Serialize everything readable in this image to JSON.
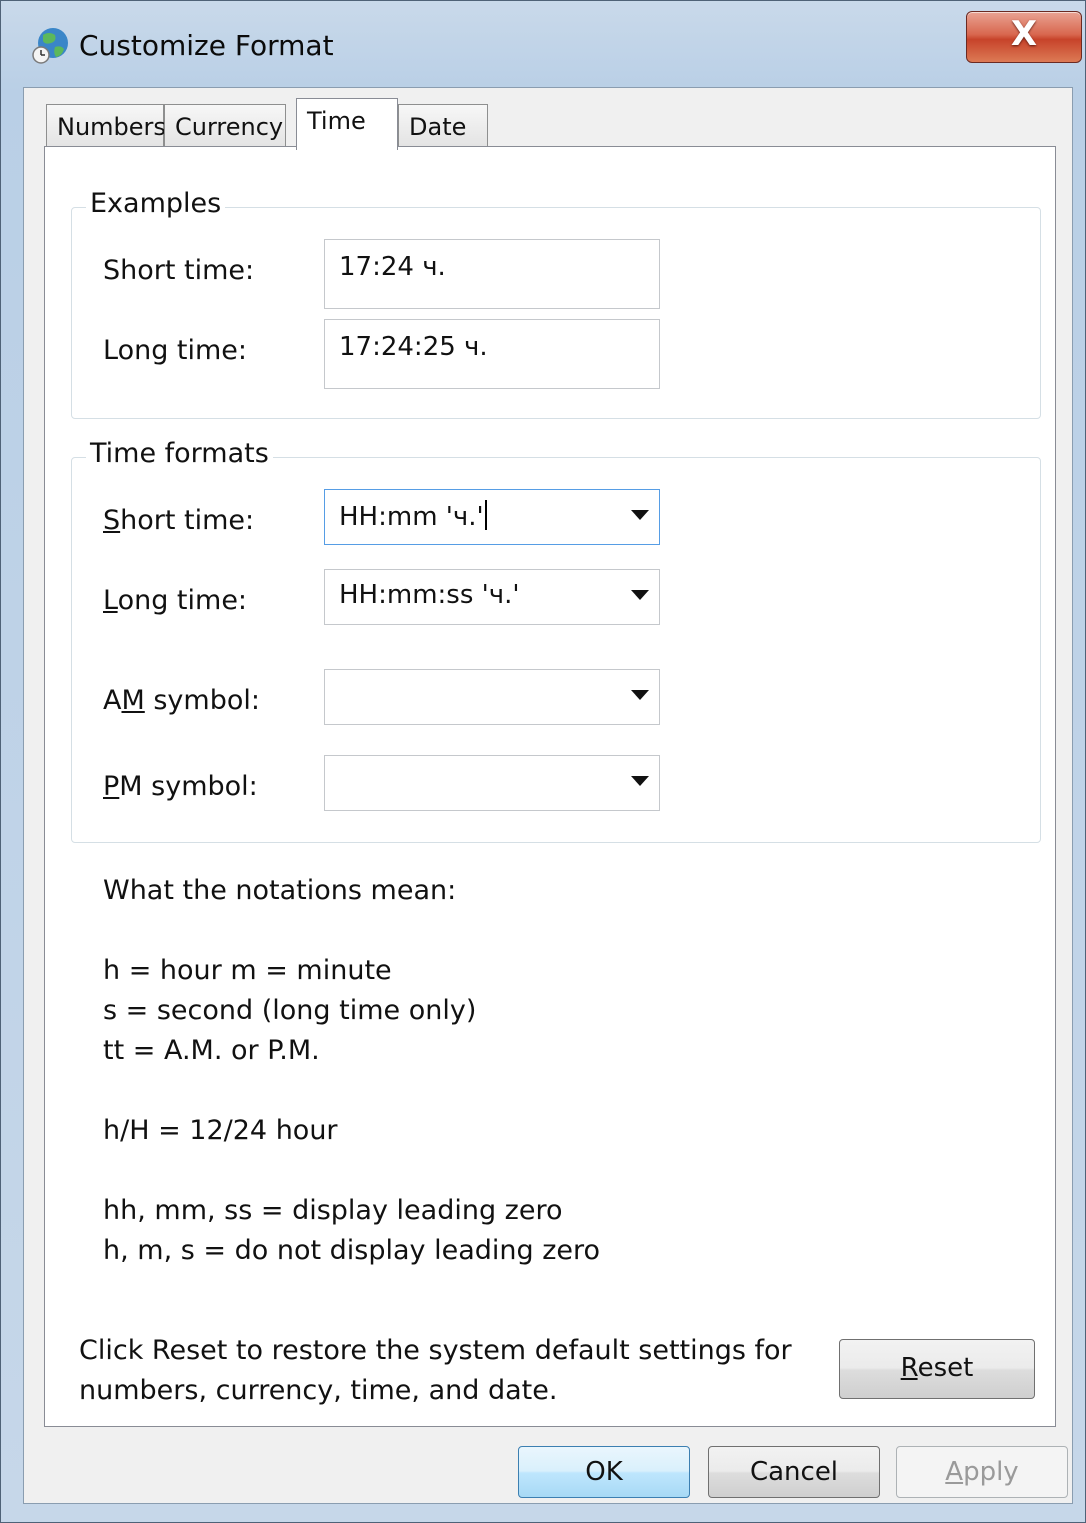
{
  "window": {
    "title": "Customize Format",
    "close_glyph": "X"
  },
  "tabs": [
    {
      "label": "Numbers"
    },
    {
      "label": "Currency"
    },
    {
      "label": "Time",
      "selected": true
    },
    {
      "label": "Date"
    }
  ],
  "examples": {
    "group_label": "Examples",
    "short_label": "Short time:",
    "short_value": "17:24 ч.",
    "long_label": "Long time:",
    "long_value": "17:24:25 ч."
  },
  "formats": {
    "group_label": "Time formats",
    "short_label_ul": "S",
    "short_label_rest": "hort time:",
    "short_value": "HH:mm 'ч.'",
    "long_label_ul": "L",
    "long_label_rest": "ong time:",
    "long_value": "HH:mm:ss 'ч.'",
    "am_label_pre": "A",
    "am_label_ul": "M",
    "am_label_rest": " symbol:",
    "am_value": "",
    "pm_label_ul": "P",
    "pm_label_rest": "M symbol:",
    "pm_value": ""
  },
  "notations": {
    "heading": "What the notations mean:",
    "line1": "h = hour   m = minute",
    "line2": "s = second (long time only)",
    "line3": "tt = A.M. or P.M.",
    "line4": "h/H = 12/24 hour",
    "line5": "hh, mm, ss = display leading zero",
    "line6": "h, m, s = do not display leading zero"
  },
  "reset": {
    "text_line1": "Click Reset to restore the system default settings for",
    "text_line2": "numbers, currency, time, and date.",
    "button_ul": "R",
    "button_rest": "eset"
  },
  "buttons": {
    "ok": "OK",
    "cancel": "Cancel",
    "apply_ul": "A",
    "apply_rest": "pply"
  },
  "colors": {
    "accent_focus": "#569de5",
    "default_button": "#bee6fd",
    "close_button": "#c7432a"
  },
  "icons": {
    "title": "globe-clock-icon",
    "close": "close-icon",
    "dropdown": "chevron-down-icon"
  }
}
